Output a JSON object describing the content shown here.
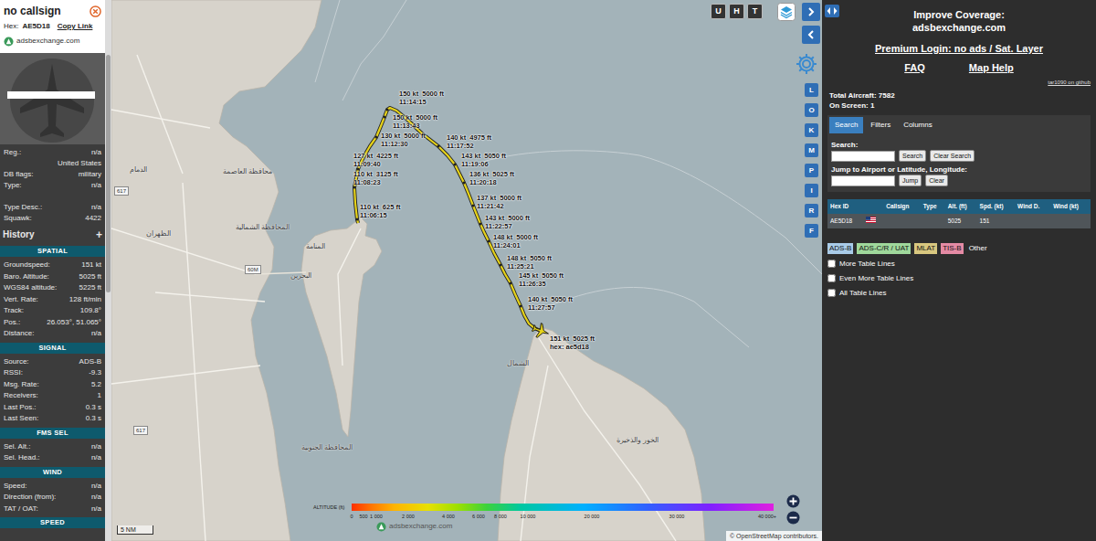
{
  "sidebar": {
    "title": "no callsign",
    "hex_label": "Hex:",
    "hex": "AE5D18",
    "copy_link": "Copy Link",
    "logo": "adsbexchange.com",
    "info": [
      {
        "label": "Reg.:",
        "value": "n/a"
      },
      {
        "label": "",
        "value": "United States"
      },
      {
        "label": "DB flags:",
        "value": "military"
      },
      {
        "label": "Type:",
        "value": "n/a"
      },
      {
        "label": "Type Desc.:",
        "value": "n/a"
      },
      {
        "label": "Squawk:",
        "value": "4422"
      }
    ],
    "history": {
      "title": "History",
      "toggle": "+"
    },
    "sections": [
      {
        "title": "SPATIAL",
        "rows": [
          {
            "label": "Groundspeed:",
            "value": "151 kt"
          },
          {
            "label": "Baro. Altitude:",
            "value": "5025 ft"
          },
          {
            "label": "WGS84 altitude:",
            "value": "5225 ft"
          },
          {
            "label": "Vert. Rate:",
            "value": "128 ft/min"
          },
          {
            "label": "Track:",
            "value": "109.8°"
          },
          {
            "label": "Pos.:",
            "value": "26.053°, 51.065°"
          },
          {
            "label": "Distance:",
            "value": "n/a"
          }
        ]
      },
      {
        "title": "SIGNAL",
        "rows": [
          {
            "label": "Source:",
            "value": "ADS-B"
          },
          {
            "label": "RSSI:",
            "value": "-9.3"
          },
          {
            "label": "Msg. Rate:",
            "value": "5.2"
          },
          {
            "label": "Receivers:",
            "value": "1"
          },
          {
            "label": "Last Pos.:",
            "value": "0.3 s"
          },
          {
            "label": "Last Seen:",
            "value": "0.3 s"
          }
        ]
      },
      {
        "title": "FMS SEL",
        "rows": [
          {
            "label": "Sel. Alt.:",
            "value": "n/a"
          },
          {
            "label": "Sel. Head.:",
            "value": "n/a"
          }
        ]
      },
      {
        "title": "WIND",
        "rows": [
          {
            "label": "Speed:",
            "value": "n/a"
          },
          {
            "label": "Direction (from):",
            "value": "n/a"
          },
          {
            "label": "TAT / OAT:",
            "value": "n/a"
          }
        ]
      },
      {
        "title": "SPEED",
        "rows": []
      }
    ]
  },
  "map": {
    "layer_buttons": [
      "U",
      "H",
      "T"
    ],
    "side_buttons": [
      "L",
      "O",
      "K",
      "M",
      "P",
      "I",
      "R",
      "F"
    ],
    "places": [
      "الدمام",
      "الظهران",
      "محافظة العاصمة",
      "المحافظة الشمالية",
      "المنامة",
      "البحرين",
      "المحافظة الجنوبية",
      "الشمال",
      "الخور والذخيرة"
    ],
    "road_shields": [
      "617",
      "60M",
      "617"
    ],
    "scale": "5 NM",
    "track": [
      {
        "speed": "110 kt",
        "altitude": "625 ft",
        "time": "11:06:15"
      },
      {
        "speed": "110 kt",
        "altitude": "3125 ft",
        "time": "11:08:23"
      },
      {
        "speed": "127 kt",
        "altitude": "4225 ft",
        "time": "11:09:40"
      },
      {
        "speed": "130 kt",
        "altitude": "5000 ft",
        "time": "11:12:30"
      },
      {
        "speed": "150 kt",
        "altitude": "5000 ft",
        "time": "11:13:43"
      },
      {
        "speed": "150 kt",
        "altitude": "5000 ft",
        "time": "11:14:15"
      },
      {
        "speed": "140 kt",
        "altitude": "4975 ft",
        "time": "11:17:52"
      },
      {
        "speed": "143 kt",
        "altitude": "5050 ft",
        "time": "11:19:06"
      },
      {
        "speed": "136 kt",
        "altitude": "5025 ft",
        "time": "11:20:18"
      },
      {
        "speed": "137 kt",
        "altitude": "5000 ft",
        "time": "11:21:42"
      },
      {
        "speed": "143 kt",
        "altitude": "5000 ft",
        "time": "11:22:57"
      },
      {
        "speed": "148 kt",
        "altitude": "5000 ft",
        "time": "11:24:01"
      },
      {
        "speed": "148 kt",
        "altitude": "5050 ft",
        "time": "11:25:21"
      },
      {
        "speed": "145 kt",
        "altitude": "5050 ft",
        "time": "11:26:35"
      },
      {
        "speed": "140 kt",
        "altitude": "5050 ft",
        "time": "11:27:57"
      }
    ],
    "aircraft": {
      "speed": "151 kt",
      "altitude": "5025 ft",
      "hex": "hex: ae5d18"
    },
    "legend": {
      "title": "ALTITUDE (ft)",
      "ticks": [
        "0",
        "500",
        "1 000",
        "2 000",
        "4 000",
        "6 000",
        "8 000",
        "10 000",
        "20 000",
        "30 000",
        "40 000+"
      ]
    },
    "watermark": "adsbexchange.com",
    "attribution": "© OpenStreetMap contributors."
  },
  "panel": {
    "coverage": "Improve Coverage:",
    "site": "adsbexchange.com",
    "premium": "Premium Login: no ads / Sat. Layer",
    "links": [
      "FAQ",
      "Map Help"
    ],
    "github": "tar1090 on github",
    "total": "Total Aircraft: 7582",
    "on_screen": "On Screen: 1",
    "tabs": [
      {
        "label": "Search",
        "selected": true
      },
      {
        "label": "Filters",
        "selected": false
      },
      {
        "label": "Columns",
        "selected": false
      }
    ],
    "search": {
      "label": "Search:",
      "button": "Search",
      "clear": "Clear Search",
      "jump_label": "Jump to Airport or Latitude, Longitude:",
      "jump": "Jump",
      "jump_clear": "Clear"
    },
    "table": {
      "columns": [
        "Hex ID",
        "",
        "Callsign",
        "Type",
        "Alt. (ft)",
        "Spd. (kt)",
        "Wind D.",
        "Wind (kt)"
      ],
      "rows": [
        {
          "cells": [
            "AE5D18",
            "",
            "",
            "",
            "5025",
            "151",
            "",
            ""
          ],
          "selected": true
        }
      ]
    },
    "sources": [
      {
        "label": "ADS-B",
        "color": "#a9cbe8"
      },
      {
        "label": "ADS-C/R / UAT",
        "color": "#9fd89b"
      },
      {
        "label": "MLAT",
        "color": "#d8c77f"
      },
      {
        "label": "TIS-B",
        "color": "#e48aa4"
      },
      {
        "label": "Other",
        "color": "#2d2d2d"
      }
    ],
    "options": [
      {
        "label": "More Table Lines",
        "checked": false
      },
      {
        "label": "Even More Table Lines",
        "checked": false
      },
      {
        "label": "All Table Lines",
        "checked": false
      }
    ]
  }
}
